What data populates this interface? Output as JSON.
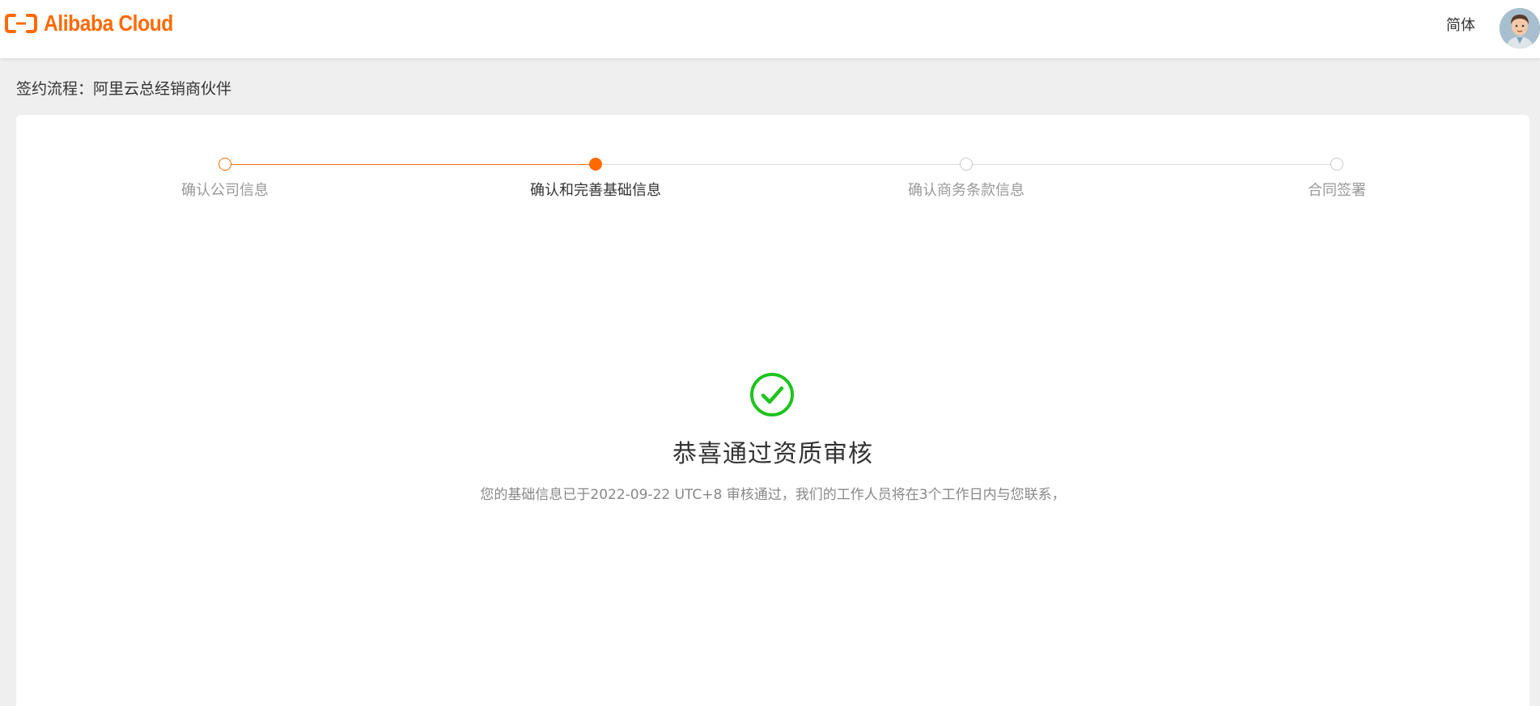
{
  "header": {
    "logo_text": "Alibaba Cloud",
    "language_label": "简体"
  },
  "breadcrumb": {
    "text": "签约流程：阿里云总经销商伙伴"
  },
  "steps": [
    {
      "label": "确认公司信息",
      "status": "done"
    },
    {
      "label": "确认和完善基础信息",
      "status": "active"
    },
    {
      "label": "确认商务条款信息",
      "status": "pending"
    },
    {
      "label": "合同签署",
      "status": "pending"
    }
  ],
  "result": {
    "icon": "check-circle-icon",
    "title": "恭喜通过资质审核",
    "description": "您的基础信息已于2022-09-22 UTC+8 审核通过，我们的工作人员将在3个工作日内与您联系，"
  },
  "colors": {
    "brand": "#ff6a00",
    "success": "#1ec41e",
    "pending": "#c8c8c8"
  }
}
